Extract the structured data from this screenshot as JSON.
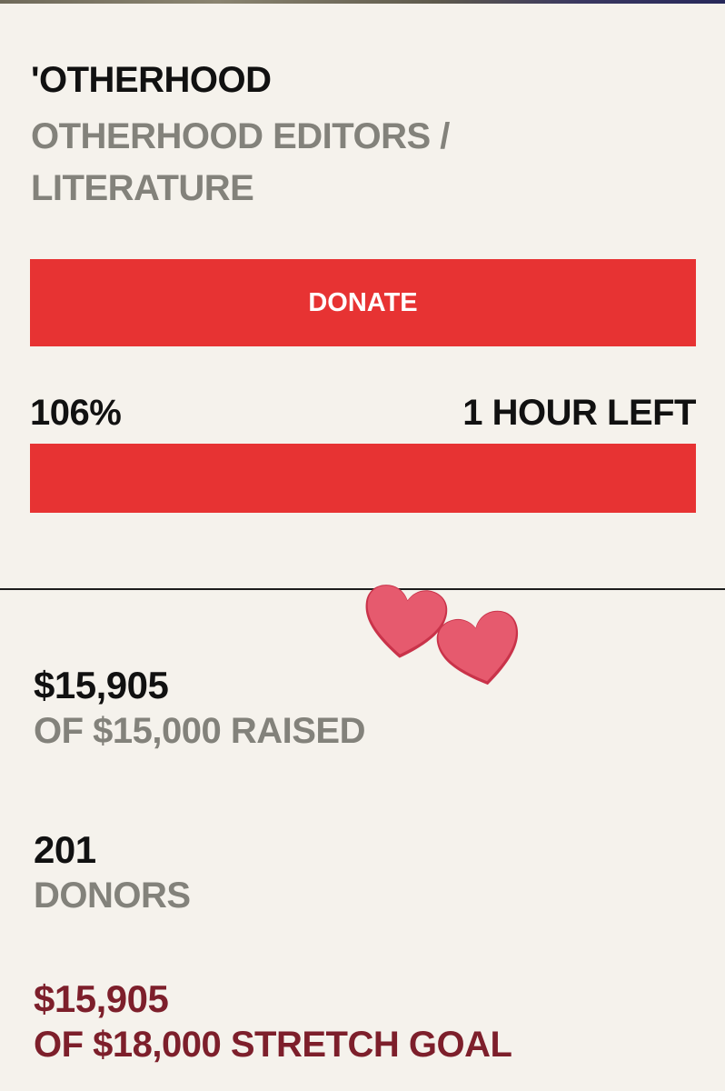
{
  "campaign": {
    "title": "'OTHERHOOD",
    "subtitle": "OTHERHOOD EDITORS / LITERATURE"
  },
  "actions": {
    "donate_label": "DONATE"
  },
  "progress": {
    "percent_label": "106%",
    "time_left": "1 HOUR LEFT",
    "fill_percent": 100
  },
  "stats": {
    "raised_amount": "$15,905",
    "raised_label": "OF $15,000 RAISED",
    "donors_count": "201",
    "donors_label": "DONORS",
    "stretch_amount": "$15,905",
    "stretch_label": "OF $18,000 STRETCH GOAL"
  },
  "colors": {
    "background": "#f5f2ec",
    "accent": "#e73333",
    "muted_text": "#83827b",
    "stretch_text": "#7d1f2b",
    "heart": "#e65a6e"
  },
  "decorations": {
    "sticker": "heart-icon"
  }
}
